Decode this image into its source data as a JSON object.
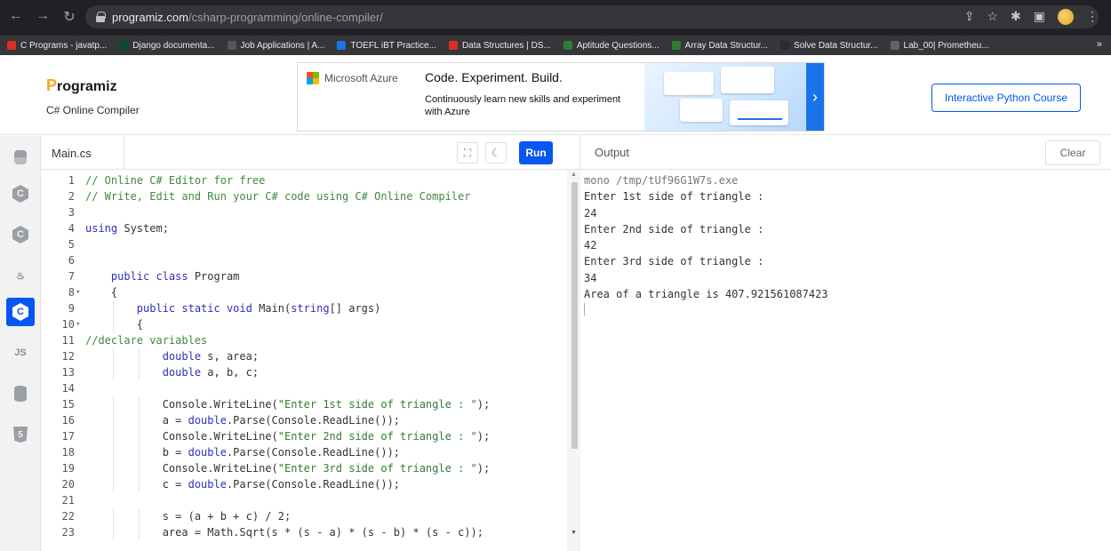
{
  "browser": {
    "url_host": "programiz.com",
    "url_path": "/csharp-programming/online-compiler/",
    "bookmarks": [
      {
        "label": "C Programs - javatp...",
        "color": "#d93025"
      },
      {
        "label": "Django documenta...",
        "color": "#0c4b33"
      },
      {
        "label": "Job Applications | A...",
        "color": "#555555"
      },
      {
        "label": "TOEFL iBT Practice...",
        "color": "#1a73e8"
      },
      {
        "label": "Data Structures | DS...",
        "color": "#d93025"
      },
      {
        "label": "Aptitude Questions...",
        "color": "#2e7d32"
      },
      {
        "label": "Array Data Structur...",
        "color": "#2e7d32"
      },
      {
        "label": "Solve Data Structur...",
        "color": "#2b2b2b"
      },
      {
        "label": "Lab_00| Prometheu...",
        "color": "#5f6368"
      }
    ],
    "more": "»"
  },
  "header": {
    "logo": "rogramiz",
    "logo_p": "P",
    "subtitle": "C# Online Compiler",
    "course_button": "Interactive Python Course"
  },
  "ad": {
    "brand": "Microsoft Azure",
    "title": "Code. Experiment. Build.",
    "body": "Continuously learn new skills and experiment with Azure",
    "arrow": "›"
  },
  "languages": [
    {
      "name": "python",
      "label": "",
      "active": false
    },
    {
      "name": "c",
      "label": "C",
      "active": false
    },
    {
      "name": "cpp",
      "label": "C",
      "active": false
    },
    {
      "name": "java",
      "label": "♨",
      "active": false
    },
    {
      "name": "csharp",
      "label": "C",
      "active": true
    },
    {
      "name": "javascript",
      "label": "JS",
      "active": false
    },
    {
      "name": "sql",
      "label": "",
      "active": false
    },
    {
      "name": "html",
      "label": "5",
      "active": false
    }
  ],
  "editor": {
    "filename": "Main.cs",
    "run_label": "Run",
    "lines": [
      {
        "n": "1",
        "text": "// Online C# Editor for free",
        "c": "com"
      },
      {
        "n": "2",
        "text": "// Write, Edit and Run your C# code using C# Online Compiler",
        "c": "com"
      },
      {
        "n": "3",
        "text": ""
      },
      {
        "n": "4",
        "html": "<span style=\"color:#2f2fbb\">using</span> System;"
      },
      {
        "n": "5",
        "text": ""
      },
      {
        "n": "6",
        "text": ""
      },
      {
        "n": "7",
        "html": "    <span style=\"color:#2f2fbb\">public class</span> Program"
      },
      {
        "n": "8",
        "text": "    {",
        "fold": true
      },
      {
        "n": "9",
        "html": "        <span style=\"color:#2f2fbb\">public static void</span> Main(<span style=\"color:#2f2fbb\">string</span>[] args)"
      },
      {
        "n": "10",
        "text": "        {",
        "fold": true
      },
      {
        "n": "11",
        "text": "//declare variables",
        "c": "com"
      },
      {
        "n": "12",
        "html": "            <span style=\"color:#2f2fbb\">double</span> s, area;"
      },
      {
        "n": "13",
        "html": "            <span style=\"color:#2f2fbb\">double</span> a, b, c;"
      },
      {
        "n": "14",
        "text": ""
      },
      {
        "n": "15",
        "html": "            Console.WriteLine(<span style=\"color:#2e7d32\">\"Enter 1st side of triangle : \"</span>);"
      },
      {
        "n": "16",
        "html": "            a = <span style=\"color:#2f2fbb\">double</span>.Parse(Console.ReadLine());"
      },
      {
        "n": "17",
        "html": "            Console.WriteLine(<span style=\"color:#2e7d32\">\"Enter 2nd side of triangle : \"</span>);"
      },
      {
        "n": "18",
        "html": "            b = <span style=\"color:#2f2fbb\">double</span>.Parse(Console.ReadLine());"
      },
      {
        "n": "19",
        "html": "            Console.WriteLine(<span style=\"color:#2e7d32\">\"Enter 3rd side of triangle : \"</span>);"
      },
      {
        "n": "20",
        "html": "            c = <span style=\"color:#2f2fbb\">double</span>.Parse(Console.ReadLine());"
      },
      {
        "n": "21",
        "text": ""
      },
      {
        "n": "22",
        "text": "            s = (a + b + c) / 2;"
      },
      {
        "n": "23",
        "text": "            area = Math.Sqrt(s * (s - a) * (s - b) * (s - c));"
      }
    ]
  },
  "output": {
    "title": "Output",
    "clear_label": "Clear",
    "lines": [
      {
        "text": "mono /tmp/tUf96G1W7s.exe",
        "cmd": true
      },
      {
        "text": "Enter 1st side of triangle :"
      },
      {
        "text": "24"
      },
      {
        "text": "Enter 2nd side of triangle :"
      },
      {
        "text": "42"
      },
      {
        "text": "Enter 3rd side of triangle :"
      },
      {
        "text": "34"
      },
      {
        "text": "Area of a triangle is 407.921561087423"
      }
    ]
  },
  "colors": {
    "accent": "#0556f3",
    "logo_accent": "#f5a623",
    "comment": "#3c8a3c",
    "keyword": "#2f2fbb",
    "string": "#2e7d32"
  }
}
